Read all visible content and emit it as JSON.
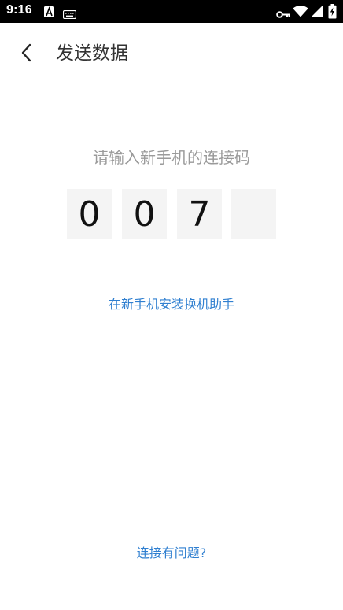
{
  "status_bar": {
    "time": "9:16",
    "icons": [
      "a-badge-icon",
      "keyboard-icon",
      "vpn-key-icon",
      "wifi-icon",
      "signal-icon",
      "battery-charging-icon"
    ]
  },
  "header": {
    "back_icon": "chevron-left-icon",
    "title": "发送数据"
  },
  "main": {
    "prompt": "请输入新手机的连接码",
    "code_digits": [
      "0",
      "0",
      "7",
      ""
    ],
    "install_link": "在新手机安装换机助手",
    "help_link": "连接有问题?"
  },
  "colors": {
    "link": "#2f7fd0",
    "prompt": "#9a9a9a",
    "code_box_bg": "#f4f4f4"
  }
}
